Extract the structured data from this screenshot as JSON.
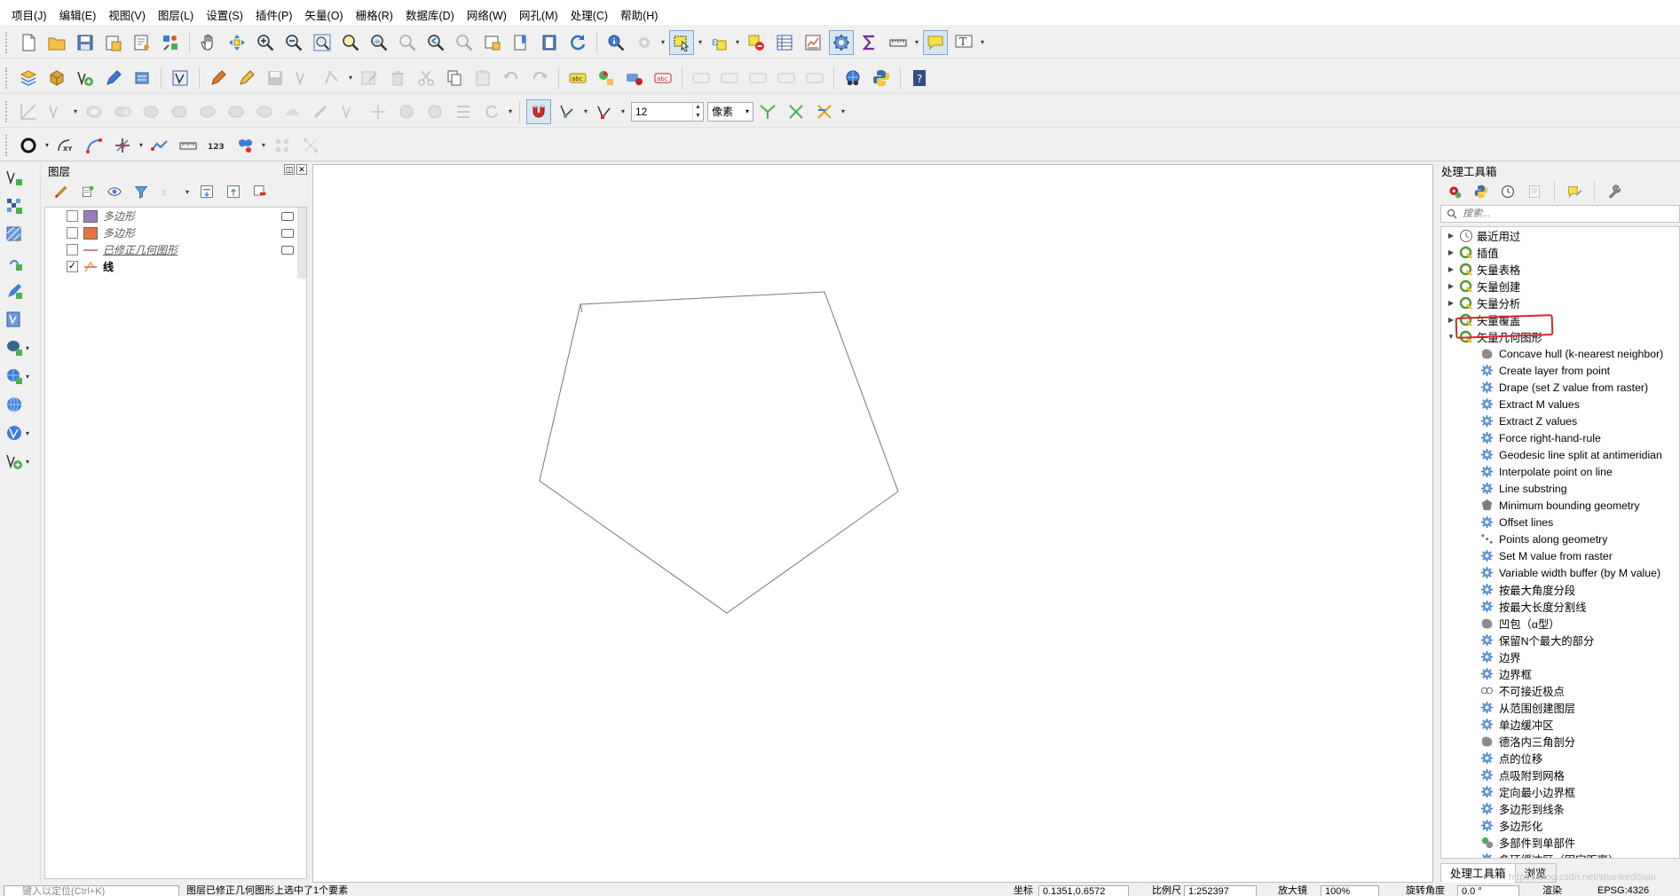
{
  "menu": [
    "项目(J)",
    "编辑(E)",
    "视图(V)",
    "图层(L)",
    "设置(S)",
    "插件(P)",
    "矢量(O)",
    "栅格(R)",
    "数据库(D)",
    "网络(W)",
    "网孔(M)",
    "处理(C)",
    "帮助(H)"
  ],
  "snapping": {
    "tolerance": "12",
    "unit": "像素"
  },
  "layers_panel": {
    "title": "图层",
    "layers": [
      {
        "name": "多边形",
        "checked": false,
        "symbol": "polygon",
        "color": "#9b7bbf"
      },
      {
        "name": "多边形",
        "checked": false,
        "symbol": "polygon",
        "color": "#e8743b"
      },
      {
        "name": "已修正几何图形",
        "checked": false,
        "symbol": "line",
        "color": "#c9605a"
      },
      {
        "name": "线",
        "checked": true,
        "symbol": "line-active",
        "color": "#e8a93b"
      }
    ]
  },
  "toolbox": {
    "title": "处理工具箱",
    "search_placeholder": "搜索...",
    "groups": [
      "最近用过",
      "插值",
      "矢量表格",
      "矢量创建",
      "矢量分析",
      "矢量覆盖"
    ],
    "expanded_group": "矢量几何图形",
    "algorithms": [
      "Concave hull (k-nearest neighbor)",
      "Create layer from point",
      "Drape (set Z value from raster)",
      "Extract M values",
      "Extract Z values",
      "Force right-hand-rule",
      "Geodesic line split at antimeridian",
      "Interpolate point on line",
      "Line substring",
      "Minimum bounding geometry",
      "Offset lines",
      "Points along geometry",
      "Set M value from raster",
      "Variable width buffer (by M value)",
      "按最大角度分段",
      "按最大长度分割线",
      "凹包（α型）",
      "保留N个最大的部分",
      "边界",
      "边界框",
      "不可接近极点",
      "从范围创建图层",
      "单边缓冲区",
      "德洛内三角剖分",
      "点的位移",
      "点吸附到网格",
      "定向最小边界框",
      "多边形到线条",
      "多边形化",
      "多部件到单部件",
      "多环缓冲区（固定距离）"
    ],
    "tabs": [
      "处理工具箱",
      "浏览"
    ]
  },
  "statusbar": {
    "locator_placeholder": "键入以定位(Ctrl+K)",
    "message": "图层已修正几何图形上选中了1个要素",
    "coord_label": "坐标",
    "coord": "0.1351,0.6572",
    "scale_label": "比例尺",
    "scale": "1:252397",
    "magnifier_label": "放大镜",
    "magnifier": "100%",
    "rotation_label": "旋转角度",
    "rotation": "0.0 °",
    "render_label": "渲染",
    "epsg": "EPSG:4326"
  },
  "watermark": "https://blog.csdn.net/shankedi5xin",
  "colors": {
    "qgis_green": "#589632",
    "highlight_red": "#d9262c",
    "polygon_stroke": "#777777"
  }
}
